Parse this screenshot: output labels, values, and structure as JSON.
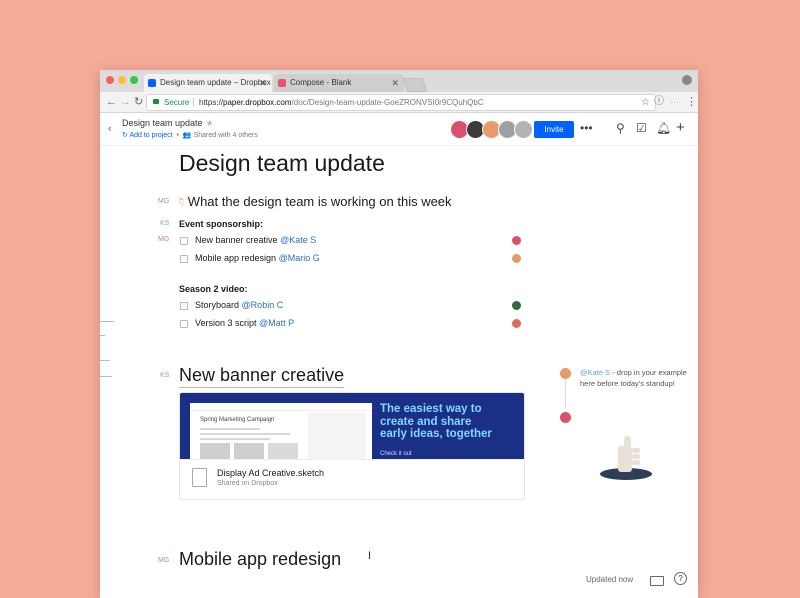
{
  "browser": {
    "tabs": [
      {
        "label": "Design team update – Dropbox",
        "active": true
      },
      {
        "label": "Compose - Blank",
        "active": false
      }
    ],
    "secure_label": "Secure",
    "url_prefix": "https://",
    "url_host": "paper.dropbox.com",
    "url_path": "/doc/Design-team-update-GoeZRONVSI0r9CQuhQbC"
  },
  "doc_header": {
    "title": "Design team update",
    "add_to_project": "Add to project",
    "shared_with": "Shared with 4 others",
    "invite_label": "Invite",
    "more_icon": "ellipsis-icon",
    "search_icon": "search-icon",
    "checklist_icon": "checklist-icon",
    "bell_icon": "bell-icon",
    "plus_icon": "plus-icon",
    "avatar_colors": [
      "#d9526b",
      "#3b3b3b",
      "#e89a6a",
      "#9aa0a6",
      "#b3b3b3"
    ]
  },
  "document": {
    "title": "Design team update",
    "section_heading": "What the design team is working on this week",
    "initials": {
      "mg": "MG",
      "ks": "KS"
    },
    "event_sponsorship": {
      "heading": "Event sponsorship:",
      "tasks": [
        {
          "label": "New banner creative",
          "mention": "@Kate S"
        },
        {
          "label": "Mobile app redesign",
          "mention": "@Mario G"
        }
      ]
    },
    "season2": {
      "heading": "Season 2 video:",
      "tasks": [
        {
          "label": "Storyboard",
          "mention": "@Robin C"
        },
        {
          "label": "Version 3 script",
          "mention": "@Matt P"
        }
      ]
    },
    "banner_heading": "New banner creative",
    "mobile_heading": "Mobile app redesign"
  },
  "embed": {
    "preview_title": "Spring Marketing Campaign",
    "promo_line1": "The easiest way to",
    "promo_line2": "create and share",
    "promo_line3": "early ideas, together",
    "promo_cta": "Check it out",
    "file_name": "Display Ad Creative.sketch",
    "file_sub": "Shared on Dropbox"
  },
  "comment": {
    "mention": "@Kate S",
    "text": " - drop in your example here before today's standup!"
  },
  "footer": {
    "updated": "Updated now",
    "help": "?"
  },
  "colors": {
    "background": "#f6aa98",
    "accent": "#0061fe",
    "mention": "#2d6fbd"
  }
}
